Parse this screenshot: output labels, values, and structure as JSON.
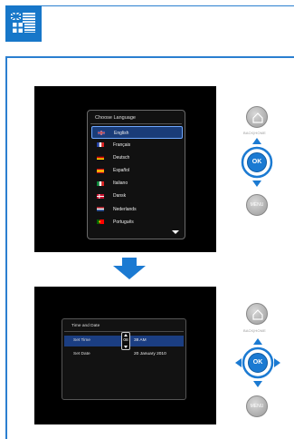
{
  "header": {
    "logo_icon": "language-flags-icon",
    "brand_color": "#1777c9"
  },
  "step1": {
    "dialog_title": "Choose  Language",
    "languages": [
      {
        "name": "English",
        "selected": true
      },
      {
        "name": "Français",
        "selected": false
      },
      {
        "name": "Deutsch",
        "selected": false
      },
      {
        "name": "Español",
        "selected": false
      },
      {
        "name": "Italiano",
        "selected": false
      },
      {
        "name": "Dansk",
        "selected": false
      },
      {
        "name": "Nederlands",
        "selected": false
      },
      {
        "name": "Português",
        "selected": false
      }
    ],
    "remote": {
      "backhome_label": "BACK|HOME",
      "ok_label": "OK",
      "menu_label": "MENU"
    }
  },
  "step2": {
    "dialog_title": "Time and Date",
    "rows": [
      {
        "label": "Set Time",
        "value_hour": "08",
        "value_rest": "38  AM"
      },
      {
        "label": "Set Date",
        "value": "20  January  2010"
      }
    ],
    "remote": {
      "backhome_label": "BACK|HOME",
      "ok_label": "OK",
      "menu_label": "MENU"
    }
  }
}
